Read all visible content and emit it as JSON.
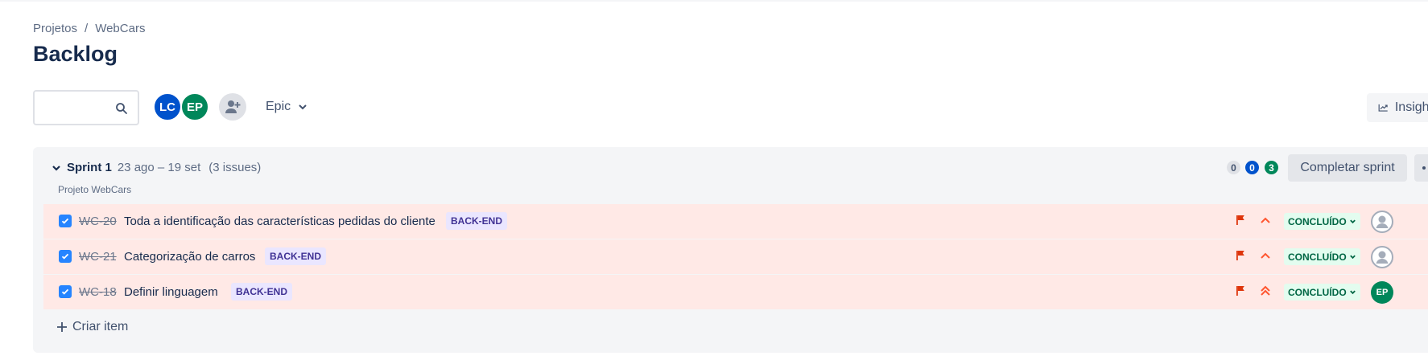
{
  "breadcrumb": {
    "project_root": "Projetos",
    "separator": "/",
    "project": "WebCars"
  },
  "page": {
    "title": "Backlog"
  },
  "search": {
    "placeholder": "",
    "value": ""
  },
  "avatars": [
    {
      "initials": "LC",
      "color": "#0052cc"
    },
    {
      "initials": "EP",
      "color": "#00875a"
    }
  ],
  "add_people_icon": "add-user-icon",
  "epic_filter": {
    "label": "Epic"
  },
  "insights": {
    "label": "Insights"
  },
  "sprint": {
    "name": "Sprint 1",
    "dates": "23 ago – 19 set",
    "issue_count": "(3 issues)",
    "project_label": "Projeto WebCars",
    "counts": {
      "todo": "0",
      "in_progress": "0",
      "done": "3"
    },
    "complete_label": "Completar sprint",
    "colors": {
      "row_bg": "#ffe9e6",
      "done_count": "#00875a",
      "progress_count": "#0052cc"
    }
  },
  "issues": [
    {
      "key": "WC-20",
      "summary": "Toda a identificação das características pedidas do cliente",
      "epic": "BACK-END",
      "priority": "high",
      "status": "CONCLUÍDO",
      "assignee": ""
    },
    {
      "key": "WC-21",
      "summary": "Categorização de carros",
      "epic": "BACK-END",
      "priority": "high",
      "status": "CONCLUÍDO",
      "assignee": ""
    },
    {
      "key": "WC-18",
      "summary": "Definir linguagem",
      "epic": "BACK-END",
      "priority": "highest",
      "status": "CONCLUÍDO",
      "assignee": "EP"
    }
  ],
  "create_item": {
    "label": "Criar item"
  }
}
